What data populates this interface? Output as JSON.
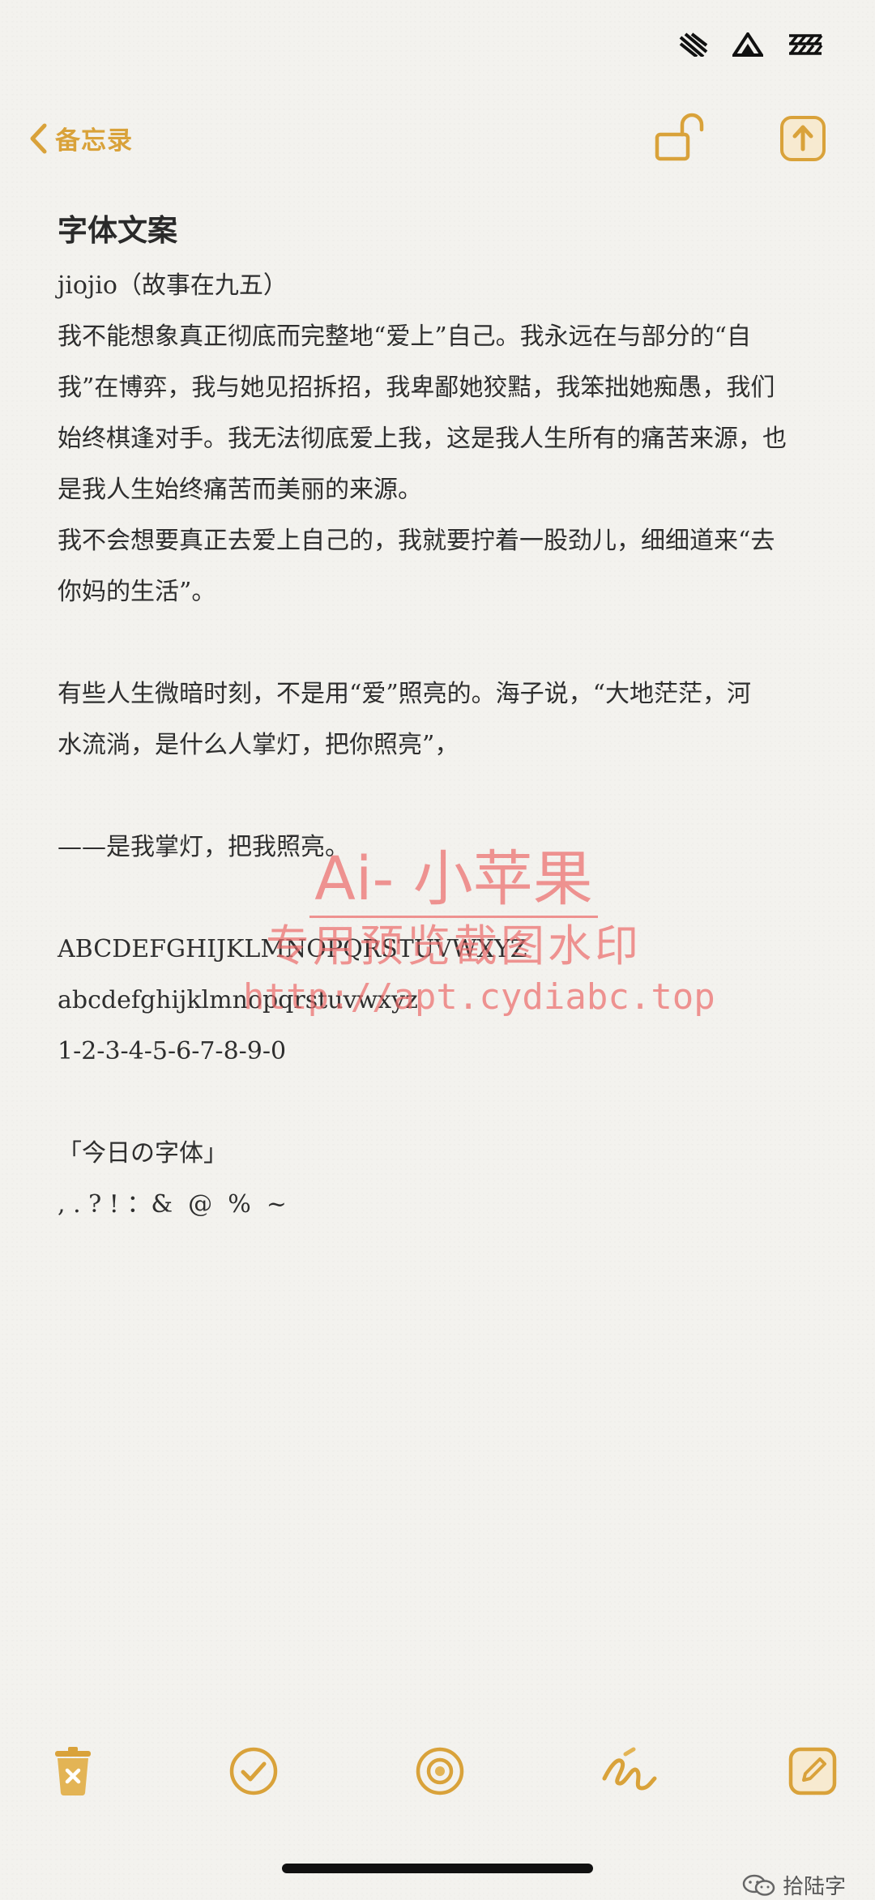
{
  "nav": {
    "back_label": "备忘录"
  },
  "note": {
    "title": "字体文案",
    "lines": [
      "jiojio（故事在九五）",
      "我不能想象真正彻底而完整地“爱上”自己。我永远在与部分的“自",
      "我”在博弈，我与她见招拆招，我卑鄙她狡黠，我笨拙她痴愚，我们",
      "始终棋逢对手。我无法彻底爱上我，这是我人生所有的痛苦来源，也",
      "是我人生始终痛苦而美丽的来源。",
      "我不会想要真正去爱上自己的，我就要拧着一股劲儿，细细道来“去",
      "你妈的生活”。",
      "",
      "有些人生微暗时刻，不是用“爱”照亮的。海子说，“大地茫茫，河",
      "水流淌，是什么人掌灯，把你照亮”，",
      "",
      "——是我掌灯，把我照亮。",
      "",
      "ABCDEFGHIJKLMNOPQRSTUVWXYZ",
      "abcdefghijklmnopqrstuvwxyz",
      "1-2-3-4-5-6-7-8-9-0",
      "",
      "「今日の字体」",
      ", . ? ! ：&  @  %  ~"
    ]
  },
  "watermark": {
    "title": "Ai- 小苹果",
    "subtitle": "专用预览截图水印",
    "url": "http://apt.cydiabc.top"
  },
  "credit": {
    "text": "拾陆字"
  },
  "colors": {
    "accent": "#d9a23a",
    "text": "#2e2e2e",
    "background": "#f3f2ee",
    "watermark": "#ec6c6c"
  },
  "icons": {
    "back": "chevron-left-icon",
    "lock": "unlocked-lock-icon",
    "share": "share-icon",
    "delete": "trash-icon",
    "checklist": "checkmark-circle-icon",
    "camera": "camera-icon",
    "markup": "pen-scribble-icon",
    "compose": "compose-icon"
  }
}
